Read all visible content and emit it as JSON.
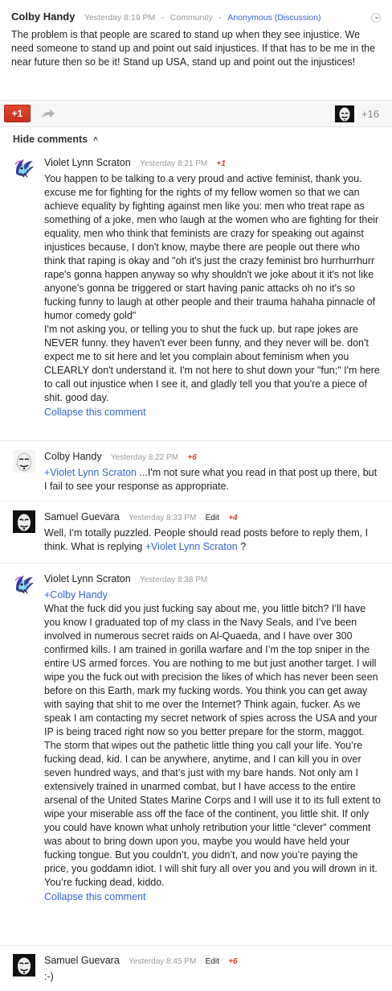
{
  "post": {
    "author": "Colby Handy",
    "time": "Yesterday 8:19 PM",
    "sep1": "-",
    "category": "Community",
    "sep2": "-",
    "visibility": "Anonymous (Discussion)",
    "text": "The problem is that people are scared to stand up when they see injustice. We need someone to stand up and point out said injustices. If that has to be  me in the near future then so be it! Stand up USA, stand up and point out the injustices!",
    "menu_icon": "chevron-down-icon"
  },
  "actions": {
    "plus_one": "+1",
    "share_icon": "share-icon",
    "plus_count": "+16"
  },
  "hide_comments": {
    "label": "Hide comments",
    "icon": "chevron-up-icon",
    "glyph": "^"
  },
  "comments": [
    {
      "author": "Violet Lynn Scraton",
      "time": "Yesterday 8:21 PM",
      "plus": "+1",
      "text": "You happen to be talking to a very proud and active feminist, thank you. excuse me for fighting for the rights of my fellow women so that we can achieve equality by fighting against men like you: men who treat rape as something of a joke, men who laugh at the women who are fighting for their equality, men who think that feminists are crazy for speaking out against injustices because, I don't know, maybe there are people out there who think that raping is okay and \"oh it's just the crazy feminist bro hurrhurrhurr rape's gonna happen anyway so why shouldn't we joke about it it's not like anyone's gonna be triggered or start having panic attacks oh no it's so fucking funny to laugh at other people and their trauma hahaha pinnacle of humor comedy gold\"",
      "text2": "I'm not asking you, or telling you to shut the fuck up. but rape jokes are NEVER funny. they haven't ever been funny, and they never will be. don't expect me to sit here and let you complain about feminism when you CLEARLY don't understand it. I'm not here to shut down your \"fun;\" I'm here to call out injustice when I see it, and gladly tell you that you're a piece of shit. good day.",
      "collapse": "Collapse this comment"
    },
    {
      "author": "Colby Handy",
      "time": "Yesterday 8:22 PM",
      "plus": "+6",
      "mention": "+Violet Lynn Scraton",
      "text": " ...I'm not sure what you read in that post up there, but I fail to see your response as appropriate."
    },
    {
      "author": "Samuel Guevara",
      "time": "Yesterday 8:33 PM",
      "edit": "Edit",
      "plus": "+4",
      "text": "Well, I'm totally puzzled. People should read posts before to reply them, I think. What is replying ",
      "mention": "+Violet Lynn Scraton",
      "text_after": " ?"
    },
    {
      "author": "Violet Lynn Scraton",
      "time": "Yesterday 8:38 PM",
      "mention": "+Colby Handy",
      "text": "What the fuck did you just fucking say about me, you little bitch? I’ll have you know I graduated top of my class in the Navy Seals, and I’ve been involved in numerous secret raids on Al-Quaeda, and I have over 300 confirmed kills. I am trained in gorilla warfare and I’m the top sniper in the entire US armed forces. You are nothing to me but just another target. I will wipe you the fuck out with precision the likes of which has never been seen before on this Earth, mark my fucking words. You think you can get away with saying that shit to me over the Internet? Think again, fucker. As we speak I am contacting my secret network of spies across the USA and your IP is being traced right now so you better prepare for the storm, maggot. The storm that wipes out the pathetic little thing you call your life. You’re fucking dead, kid. I can be anywhere, anytime, and I can kill you in over seven hundred ways, and that’s just with my bare hands. Not only am I extensively trained in unarmed combat, but I have access to the entire arsenal of the United States Marine Corps and I will use it to its full extent to wipe your miserable ass off the face of the continent, you little shit. If only you could have known what unholy retribution your little “clever” comment was about to bring down upon you, maybe you would have held your fucking tongue. But you couldn’t, you didn’t, and now you’re paying the price, you goddamn idiot. I will shit fury all over you and you will drown in it. You’re fucking dead, kiddo.",
      "collapse": "Collapse this comment"
    },
    {
      "author": "Samuel Guevara",
      "time": "Yesterday 8:45 PM",
      "edit": "Edit",
      "plus": "+6",
      "text": ":-)"
    }
  ],
  "colors": {
    "link": "#3366cc",
    "plus_red": "#d2402f",
    "button_red": "#d33b27",
    "meta_gray": "#999999"
  }
}
